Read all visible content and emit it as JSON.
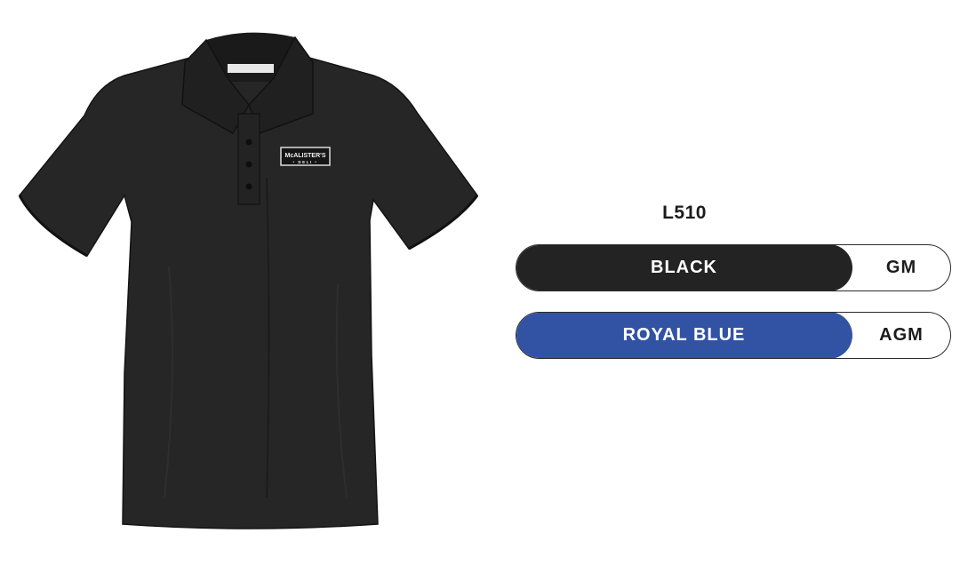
{
  "product": {
    "logo_text": "McALISTER'S",
    "logo_subtext": "DELI"
  },
  "sku": "L510",
  "options": [
    {
      "color_name": "BLACK",
      "code": "GM",
      "swatch": "#232323"
    },
    {
      "color_name": "ROYAL BLUE",
      "code": "AGM",
      "swatch": "#3253a4"
    }
  ]
}
